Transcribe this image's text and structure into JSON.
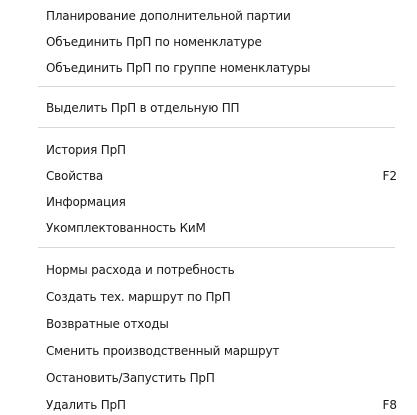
{
  "menu": {
    "items": [
      {
        "label": "Планирование дополнительной партии",
        "shortcut": ""
      },
      {
        "label": "Объединить ПрП по номенклатуре",
        "shortcut": ""
      },
      {
        "label": "Объединить ПрП по группе номенклатуры",
        "shortcut": ""
      },
      {
        "label": "Выделить ПрП в отдельную ПП",
        "shortcut": ""
      },
      {
        "label": "История ПрП",
        "shortcut": ""
      },
      {
        "label": "Свойства",
        "shortcut": "F2"
      },
      {
        "label": "Информация",
        "shortcut": ""
      },
      {
        "label": "Укомплектованность КиМ",
        "shortcut": ""
      },
      {
        "label": "Нормы расхода и потребность",
        "shortcut": ""
      },
      {
        "label": "Создать тех. маршрут по ПрП",
        "shortcut": ""
      },
      {
        "label": "Возвратные отходы",
        "shortcut": ""
      },
      {
        "label": "Сменить производственный маршрут",
        "shortcut": ""
      },
      {
        "label": "Остановить/Запустить ПрП",
        "shortcut": ""
      },
      {
        "label": "Удалить ПрП",
        "shortcut": "F8"
      }
    ]
  }
}
